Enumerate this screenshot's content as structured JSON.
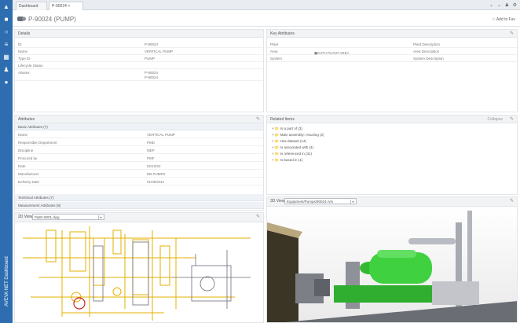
{
  "rail": {
    "brand": "AVEVA NET Dashboard"
  },
  "tabs": [
    {
      "label": "Dashboard"
    },
    {
      "label": "P-90024"
    }
  ],
  "tab_close": "×",
  "title": "P-90024 (PUMP)",
  "add_favourite": "Add to Fav",
  "details": {
    "header": "Details",
    "rows": [
      {
        "label": "ID",
        "value": "P-90024"
      },
      {
        "label": "Name",
        "value": "VERTICAL PUMP"
      },
      {
        "label": "Type ID",
        "value": "PUMP"
      },
      {
        "label": "Lifecycle Status",
        "value": ""
      },
      {
        "label": "Aliases",
        "value": "P-90024"
      },
      {
        "label": "",
        "value": "P-90024"
      }
    ]
  },
  "key_attributes": {
    "header": "Key Attributes",
    "rows": [
      {
        "c1": "Plant",
        "c2": "",
        "c3": "Plant Description"
      },
      {
        "c1": "Area",
        "c2": "SOUTH PLANT AREA",
        "c3": "Area Description"
      },
      {
        "c1": "System",
        "c2": "",
        "c3": "System Description"
      }
    ]
  },
  "attributes": {
    "header": "Attributes",
    "section_basic": "Basic Attributes (7)",
    "rows": [
      {
        "label": "Name",
        "value": "VERTICAL PUMP"
      },
      {
        "label": "Responsible Department",
        "value": "PMD"
      },
      {
        "label": "Discipline",
        "value": "MEP"
      },
      {
        "label": "Procured by",
        "value": "PMF"
      },
      {
        "label": "Date",
        "value": "02/10/22"
      },
      {
        "label": "Manufacturer",
        "value": "DB PUMPS"
      },
      {
        "label": "Delivery Date",
        "value": "01/09/2011"
      }
    ],
    "section_technical": "Technical Attributes (7)",
    "section_measurement": "Measurement Attributes (8)"
  },
  "related_items": {
    "header": "Related Items",
    "collapse": "Collapse",
    "items": [
      "+ 📁 Is a part of (3)",
      "+ 📁 Main assembly: Housing (2)",
      "+ 📁 Has dataset (14)",
      "+ 📁 Is associated with (4)",
      "+ 📁 Is referenced in (31)",
      "+ 📁 Is based in (1)"
    ]
  },
  "view_2d": {
    "label": "2D View",
    "select": "P&ID-9001.dwg"
  },
  "view_3d": {
    "label": "3D View",
    "select": "Equipment/Pumps/90024.rvm"
  },
  "colors": {
    "rail": "#2d6db0",
    "equipment": "#3fd13f"
  }
}
